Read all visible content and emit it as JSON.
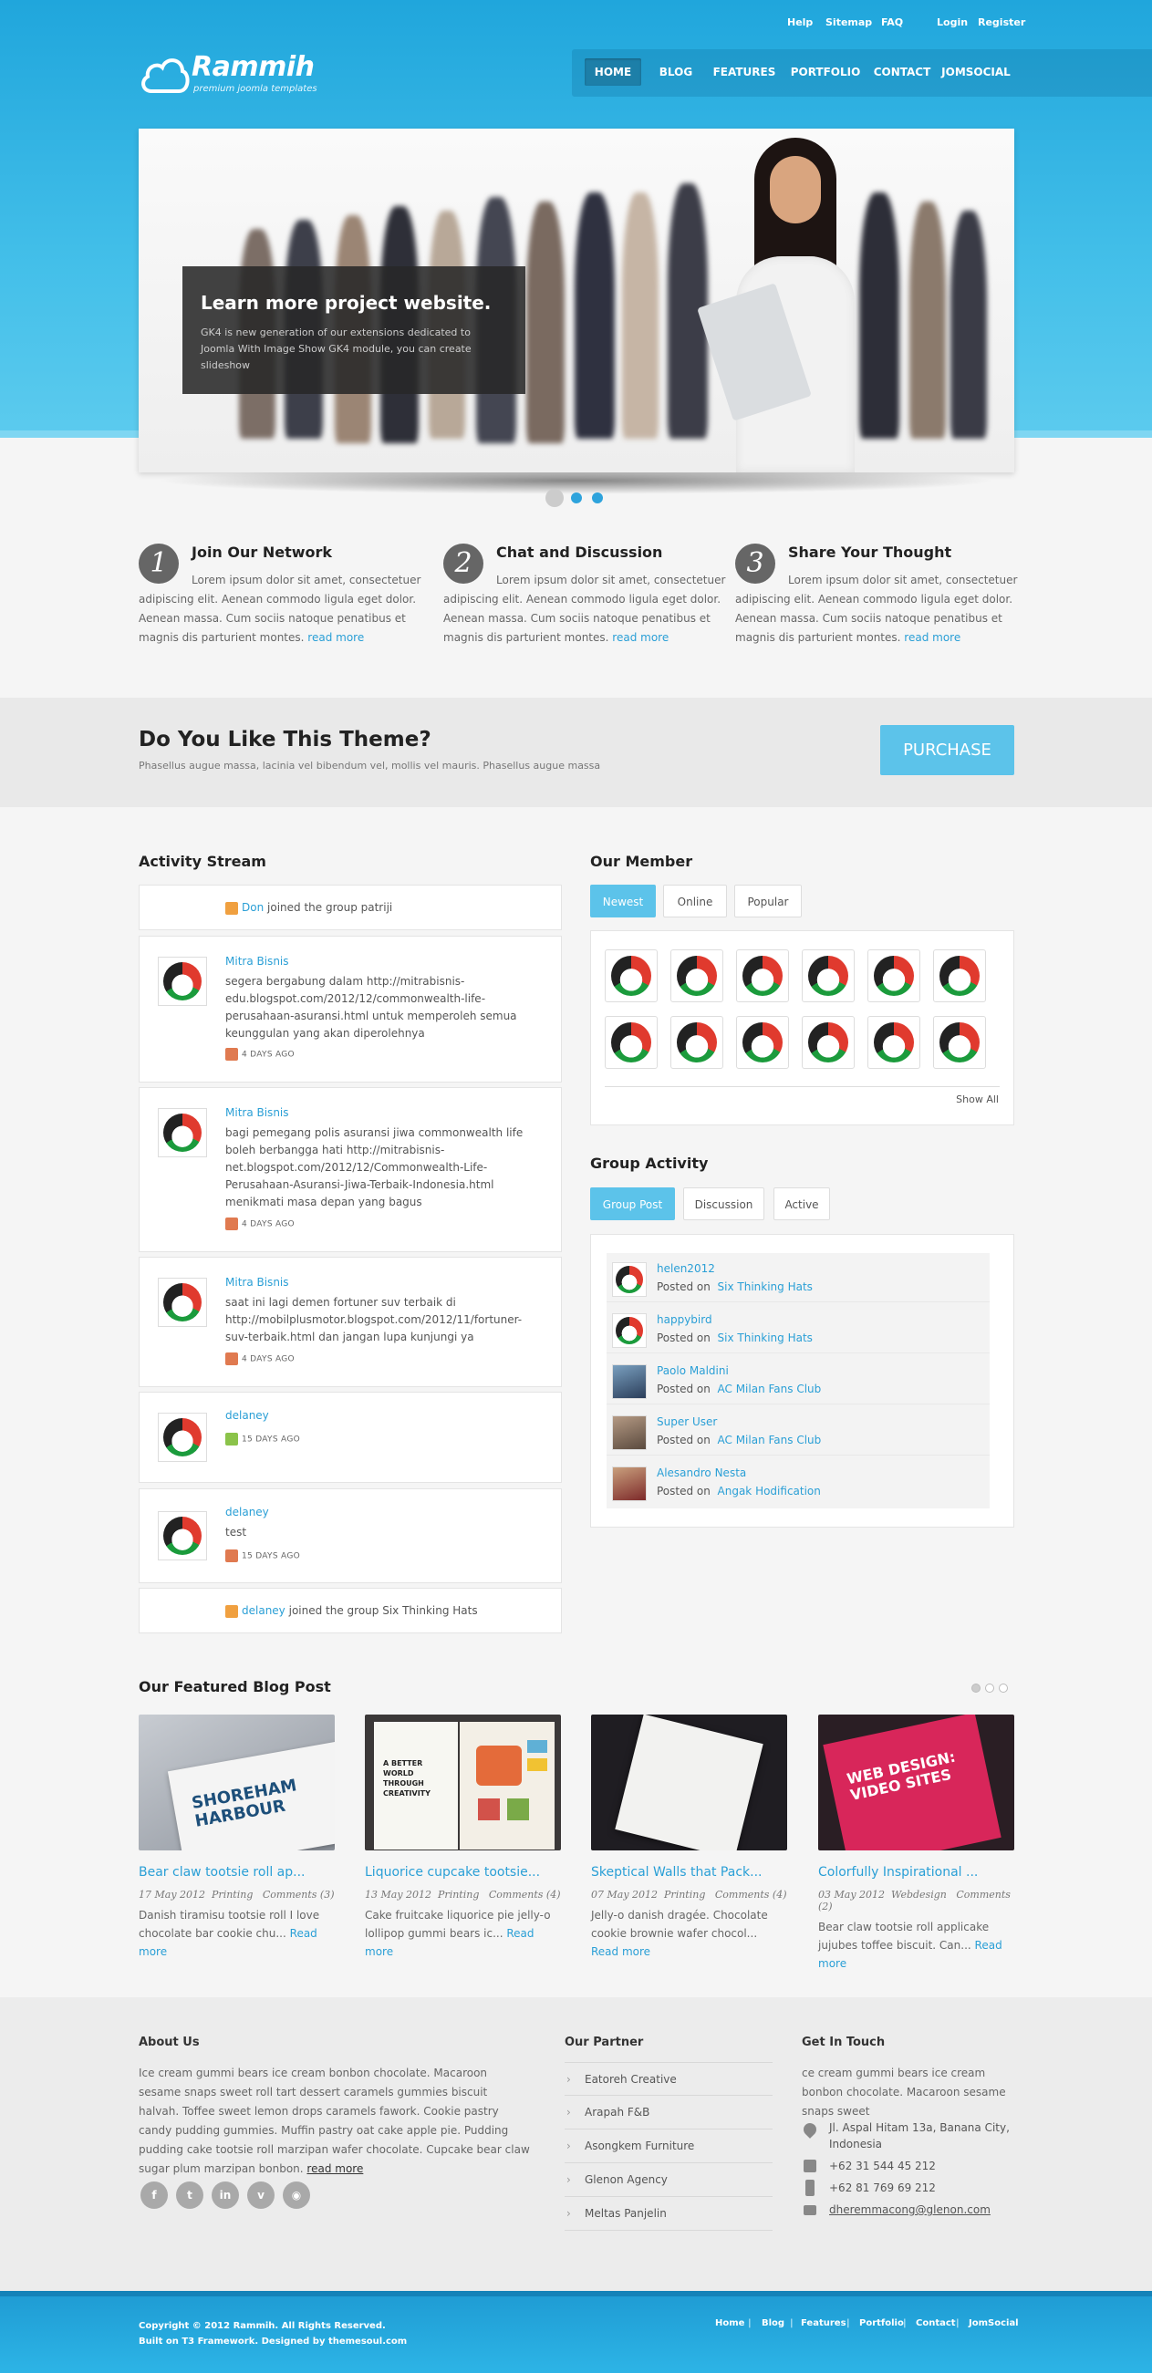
{
  "header": {
    "top_links": [
      "Help",
      "Sitemap",
      "FAQ",
      "Login",
      "Register"
    ],
    "logo_name": "Rammih",
    "logo_tagline": "premium joomla templates",
    "nav": [
      "HOME",
      "BLOG",
      "FEATURES",
      "PORTFOLIO",
      "CONTACT",
      "JOMSOCIAL"
    ]
  },
  "slider": {
    "title": "Learn more project website.",
    "text": "GK4 is new generation of our extensions dedicated to Joomla With Image Show GK4 module, you can create slideshow"
  },
  "features": [
    {
      "num": "1",
      "title": "Join Our Network",
      "text": "Lorem ipsum dolor sit amet, consectetuer adipiscing elit. Aenean commodo ligula eget dolor. Aenean massa. Cum sociis natoque penatibus et magnis dis parturient montes.",
      "more": "read more"
    },
    {
      "num": "2",
      "title": "Chat and Discussion",
      "text": "Lorem ipsum dolor sit amet, consectetuer adipiscing elit. Aenean commodo ligula eget dolor. Aenean massa. Cum sociis natoque penatibus et magnis dis parturient montes.",
      "more": "read more"
    },
    {
      "num": "3",
      "title": "Share Your Thought",
      "text": "Lorem ipsum dolor sit amet, consectetuer adipiscing elit. Aenean commodo ligula eget dolor. Aenean massa. Cum sociis natoque penatibus et magnis dis parturient montes.",
      "more": "read more"
    }
  ],
  "promo": {
    "title": "Do You Like This Theme?",
    "subtitle": "Phasellus augue massa, lacinia vel bibendum vel, mollis vel mauris. Phasellus augue massa",
    "button": "PURCHASE"
  },
  "activity": {
    "title": "Activity Stream",
    "join1": {
      "user": "Don",
      "text": "joined the group patriji"
    },
    "items": [
      {
        "name": "Mitra Bisnis",
        "text": "segera bergabung dalam http://mitrabisnis-edu.blogspot.com/2012/12/commonwealth-life-perusahaan-asuransi.html untuk memperoleh semua keunggulan yang akan diperolehnya",
        "ago": "4 DAYS AGO"
      },
      {
        "name": "Mitra Bisnis",
        "text": "bagi pemegang polis asuransi jiwa commonwealth life boleh berbangga hati http://mitrabisnis-net.blogspot.com/2012/12/Commonwealth-Life-Perusahaan-Asuransi-Jiwa-Terbaik-Indonesia.html menikmati masa depan yang bagus",
        "ago": "4 DAYS AGO"
      },
      {
        "name": "Mitra Bisnis",
        "text": "saat ini lagi demen fortuner suv terbaik di http://mobilplusmotor.blogspot.com/2012/11/fortuner-suv-terbaik.html dan jangan lupa kunjungi ya",
        "ago": "4 DAYS AGO"
      },
      {
        "name": "delaney",
        "text": "",
        "ago": "15 DAYS AGO"
      },
      {
        "name": "delaney",
        "text": "test",
        "ago": "15 DAYS AGO"
      }
    ],
    "join2": {
      "user": "delaney",
      "text": "joined the group Six Thinking Hats"
    }
  },
  "members": {
    "title": "Our Member",
    "tabs": [
      "Newest",
      "Online",
      "Popular"
    ],
    "show_all": "Show All"
  },
  "group_activity": {
    "title": "Group Activity",
    "tabs": [
      "Group Post",
      "Discussion",
      "Active"
    ],
    "posted_on": "Posted on",
    "rows": [
      {
        "user": "helen2012",
        "group": "Six Thinking Hats"
      },
      {
        "user": "happybird",
        "group": "Six Thinking Hats"
      },
      {
        "user": "Paolo Maldini",
        "group": "AC Milan Fans Club"
      },
      {
        "user": "Super User",
        "group": "AC Milan Fans Club"
      },
      {
        "user": "Alesandro Nesta",
        "group": "Angak Hodification"
      }
    ]
  },
  "blog": {
    "title": "Our Featured Blog Post",
    "posts": [
      {
        "title": "Bear claw tootsie roll ap...",
        "date": "17 May 2012",
        "cat": "Printing",
        "comments": "Comments (3)",
        "text": "Danish tiramisu tootsie roll I love chocolate bar cookie chu...",
        "more": "Read more",
        "img_text": "SHOREHAM HARBOUR"
      },
      {
        "title": "Liquorice cupcake tootsie...",
        "date": "13 May 2012",
        "cat": "Printing",
        "comments": "Comments (4)",
        "text": "Cake fruitcake liquorice pie jelly-o lollipop gummi bears ic...",
        "more": "Read more",
        "img_text": "A BETTER WORLD THROUGH CREATIVITY"
      },
      {
        "title": "Skeptical Walls that Pack...",
        "date": "07 May 2012",
        "cat": "Printing",
        "comments": "Comments (4)",
        "text": "Jelly-o danish dragée. Chocolate cookie brownie wafer chocol...",
        "more": "Read more",
        "img_text": ""
      },
      {
        "title": "Colorfully Inspirational ...",
        "date": "03 May 2012",
        "cat": "Webdesign",
        "comments": "Comments (2)",
        "text": "Bear claw tootsie roll applicake jujubes toffee biscuit. Can...",
        "more": "Read more",
        "img_text": "WEB DESIGN: VIDEO SITES"
      }
    ]
  },
  "footer": {
    "about_title": "About Us",
    "about_text": "Ice cream gummi bears ice cream bonbon chocolate. Macaroon sesame snaps sweet roll tart dessert caramels gummies biscuit halvah. Toffee sweet lemon drops caramels fawork. Cookie pastry candy pudding gummies. Muffin pastry oat cake apple pie. Pudding pudding cake tootsie roll marzipan wafer chocolate. Cupcake bear claw sugar plum marzipan bonbon.",
    "about_more": "read more",
    "partner_title": "Our Partner",
    "partners": [
      "Eatoreh Creative",
      "Arapah F&B",
      "Asongkem Furniture",
      "Glenon Agency",
      "Meltas Panjelin"
    ],
    "touch_title": "Get In Touch",
    "touch_text": "ce cream gummi bears ice cream bonbon chocolate. Macaroon sesame snaps sweet",
    "address": "Jl. Aspal Hitam 13a, Banana City, Indonesia",
    "phone": "+62 31 544 45 212",
    "mobile": "+62 81 769 69 212",
    "email": "dheremmacong@glenon.com",
    "copyright": "Copyright © 2012 Rammih. All Rights Reserved.",
    "built": "Built on T3 Framework. Designed by themesoul.com",
    "nav": [
      "Home",
      "Blog",
      "Features",
      "Portfolio",
      "Contact",
      "JomSocial"
    ]
  }
}
